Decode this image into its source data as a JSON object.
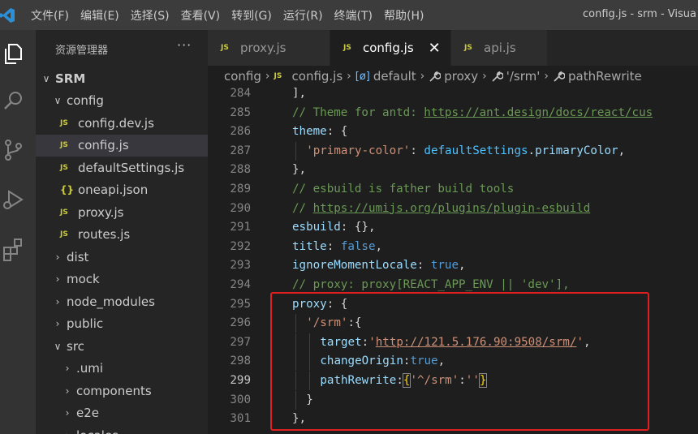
{
  "menu": [
    "文件(F)",
    "编辑(E)",
    "选择(S)",
    "查看(V)",
    "转到(G)",
    "运行(R)",
    "终端(T)",
    "帮助(H)"
  ],
  "window_title": "config.js - srm - Visua",
  "explorer": {
    "title": "资源管理器",
    "more": "···",
    "tree": [
      {
        "label": "SRM",
        "kind": "folder-open"
      },
      {
        "label": "config",
        "kind": "folder-open"
      },
      {
        "label": "config.dev.js",
        "kind": "js"
      },
      {
        "label": "config.js",
        "kind": "js",
        "selected": true
      },
      {
        "label": "defaultSettings.js",
        "kind": "js"
      },
      {
        "label": "oneapi.json",
        "kind": "json"
      },
      {
        "label": "proxy.js",
        "kind": "js"
      },
      {
        "label": "routes.js",
        "kind": "js"
      },
      {
        "label": "dist",
        "kind": "folder"
      },
      {
        "label": "mock",
        "kind": "folder"
      },
      {
        "label": "node_modules",
        "kind": "folder"
      },
      {
        "label": "public",
        "kind": "folder"
      },
      {
        "label": "src",
        "kind": "folder-open"
      },
      {
        "label": ".umi",
        "kind": "folder"
      },
      {
        "label": "components",
        "kind": "folder"
      },
      {
        "label": "e2e",
        "kind": "folder"
      },
      {
        "label": "locales",
        "kind": "folder"
      }
    ]
  },
  "tabs": [
    {
      "badge": "JS",
      "label": "proxy.js",
      "active": false
    },
    {
      "badge": "JS",
      "label": "config.js",
      "active": true,
      "close": "✕"
    },
    {
      "badge": "JS",
      "label": "api.js",
      "active": false
    }
  ],
  "breadcrumb": {
    "folder": "config",
    "file_badge": "JS",
    "file": "config.js",
    "default_icon": "[ø]",
    "default": "default",
    "proxy": "proxy",
    "srm": "'/srm'",
    "rewrite": "pathRewrite",
    "sep": "›"
  },
  "editor": {
    "current_line": "299",
    "lines": [
      {
        "n": "284",
        "t": [
          [
            "c-punc",
            "],"
          ]
        ]
      },
      {
        "n": "285",
        "t": [
          [
            "c-com",
            "// Theme for antd: "
          ],
          [
            "c-com u-link",
            "https://ant.design/docs/react/cus"
          ]
        ]
      },
      {
        "n": "286",
        "t": [
          [
            "c-key",
            "theme"
          ],
          [
            "c-punc",
            ": {"
          ]
        ]
      },
      {
        "n": "287",
        "t": [
          [
            "c-str",
            "'primary-color'"
          ],
          [
            "c-punc",
            ": "
          ],
          [
            "c-var",
            "defaultSettings"
          ],
          [
            "c-punc",
            "."
          ],
          [
            "c-key",
            "primaryColor"
          ],
          [
            "c-punc",
            ","
          ]
        ]
      },
      {
        "n": "288",
        "t": [
          [
            "c-punc",
            "},"
          ]
        ]
      },
      {
        "n": "289",
        "t": [
          [
            "c-com",
            "// esbuild is father build tools"
          ]
        ]
      },
      {
        "n": "290",
        "t": [
          [
            "c-com",
            "// "
          ],
          [
            "c-com u-link",
            "https://umijs.org/plugins/plugin-esbuild"
          ]
        ]
      },
      {
        "n": "291",
        "t": [
          [
            "c-key",
            "esbuild"
          ],
          [
            "c-punc",
            ": {},"
          ]
        ]
      },
      {
        "n": "292",
        "t": [
          [
            "c-key",
            "title"
          ],
          [
            "c-punc",
            ": "
          ],
          [
            "c-kw",
            "false"
          ],
          [
            "c-punc",
            ","
          ]
        ]
      },
      {
        "n": "293",
        "t": [
          [
            "c-key",
            "ignoreMomentLocale"
          ],
          [
            "c-punc",
            ": "
          ],
          [
            "c-kw",
            "true"
          ],
          [
            "c-punc",
            ","
          ]
        ]
      },
      {
        "n": "294",
        "t": [
          [
            "c-com",
            "// proxy: proxy[REACT_APP_ENV || 'dev'],"
          ]
        ]
      },
      {
        "n": "295",
        "t": [
          [
            "c-key",
            "proxy"
          ],
          [
            "c-punc",
            ": {"
          ]
        ]
      },
      {
        "n": "296",
        "t": [
          [
            "c-str",
            "'/srm'"
          ],
          [
            "c-punc",
            ":{"
          ]
        ]
      },
      {
        "n": "297",
        "t": [
          [
            "c-key",
            "target"
          ],
          [
            "c-punc",
            ":"
          ],
          [
            "c-str",
            "'"
          ],
          [
            "c-str u-link",
            "http://121.5.176.90:9508/srm/"
          ],
          [
            "c-str",
            "'"
          ],
          [
            "c-punc",
            ","
          ]
        ]
      },
      {
        "n": "298",
        "t": [
          [
            "c-key",
            "changeOrigin"
          ],
          [
            "c-punc",
            ":"
          ],
          [
            "c-kw",
            "true"
          ],
          [
            "c-punc",
            ","
          ]
        ]
      },
      {
        "n": "299",
        "t": [
          [
            "c-key",
            "pathRewrite"
          ],
          [
            "c-punc",
            ":"
          ],
          [
            "c-brk bracket-match",
            "{"
          ],
          [
            "c-str",
            "'^/srm'"
          ],
          [
            "c-punc",
            ":"
          ],
          [
            "c-str",
            "''"
          ],
          [
            "c-brk bracket-match",
            "}"
          ]
        ]
      },
      {
        "n": "300",
        "t": [
          [
            "c-punc",
            "}"
          ]
        ]
      },
      {
        "n": "301",
        "t": [
          [
            "c-punc",
            "},"
          ]
        ]
      }
    ]
  }
}
